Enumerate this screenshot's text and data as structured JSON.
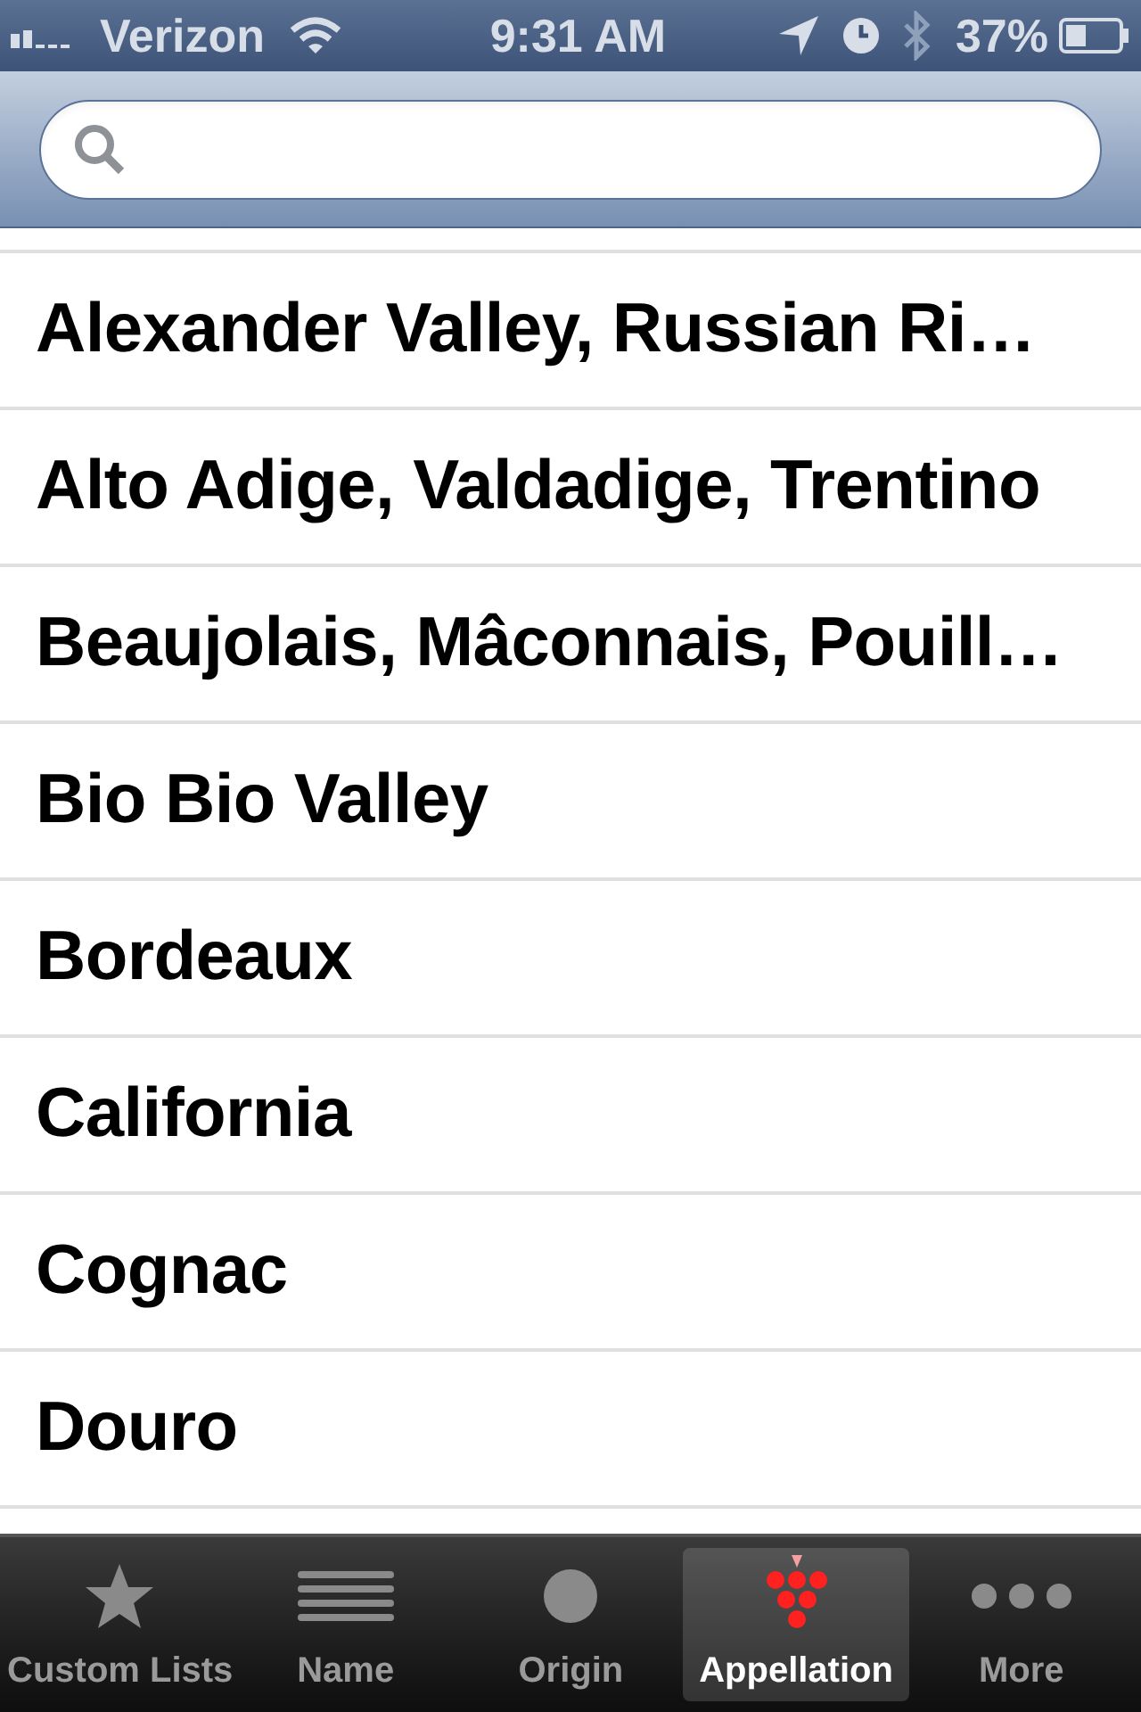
{
  "status_bar": {
    "carrier": "Verizon",
    "time": "9:31 AM",
    "battery": "37%"
  },
  "rows": [
    {
      "label": "Alexander Valley, Russian Ri…"
    },
    {
      "label": "Alto Adige, Valdadige, Trentino"
    },
    {
      "label": "Beaujolais, Mâconnais, Pouill…"
    },
    {
      "label": "Bio Bio Valley"
    },
    {
      "label": "Bordeaux"
    },
    {
      "label": "California"
    },
    {
      "label": "Cognac"
    },
    {
      "label": "Douro"
    }
  ],
  "tabs": [
    {
      "label": "Custom Lists",
      "kind": "star",
      "selected": false
    },
    {
      "label": "Name",
      "kind": "lines",
      "selected": false
    },
    {
      "label": "Origin",
      "kind": "circle",
      "selected": false
    },
    {
      "label": "Appellation",
      "kind": "grapes",
      "selected": true
    },
    {
      "label": "More",
      "kind": "dots",
      "selected": false
    }
  ]
}
